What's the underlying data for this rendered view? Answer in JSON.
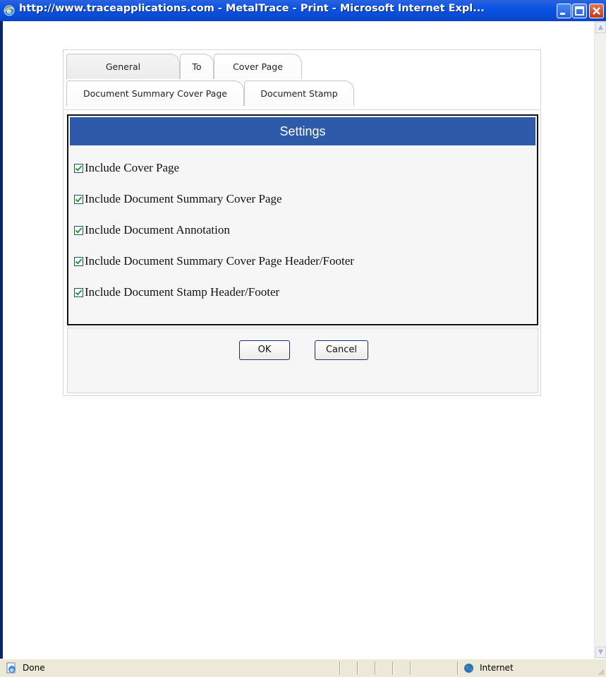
{
  "window": {
    "title": "http://www.traceapplications.com - MetalTrace - Print - Microsoft Internet Expl...",
    "icon": "ie-icon",
    "controls": [
      "minimize-icon",
      "maximize-icon",
      "close-icon"
    ]
  },
  "tabs": {
    "row1": [
      {
        "label": "General",
        "active": true
      },
      {
        "label": "To",
        "active": false
      },
      {
        "label": "Cover Page",
        "active": false
      }
    ],
    "row2": [
      {
        "label": "Document Summary Cover Page",
        "active": false
      },
      {
        "label": "Document Stamp",
        "active": false
      }
    ]
  },
  "settings": {
    "header": "Settings",
    "options": [
      {
        "label": "Include Cover Page",
        "checked": true
      },
      {
        "label": "Include Document Summary Cover Page",
        "checked": true
      },
      {
        "label": "Include Document Annotation",
        "checked": true
      },
      {
        "label": "Include Document Summary Cover Page Header/Footer",
        "checked": true
      },
      {
        "label": "Include Document Stamp Header/Footer",
        "checked": true
      }
    ]
  },
  "buttons": {
    "ok": "OK",
    "cancel": "Cancel"
  },
  "statusbar": {
    "text": "Done",
    "zone": "Internet"
  },
  "colors": {
    "titlebar": "#0a54e6",
    "settings_header": "#2d5aa9",
    "checkmark": "#21a121"
  }
}
